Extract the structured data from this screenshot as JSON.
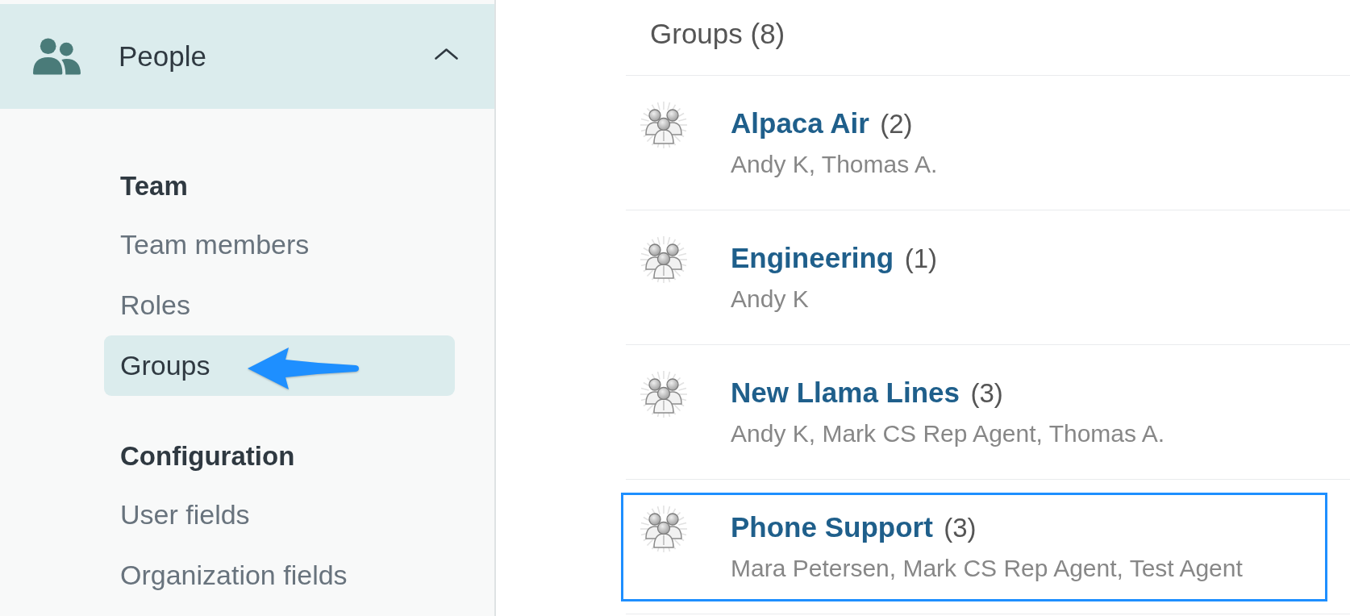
{
  "sidebar": {
    "section": {
      "label": "People",
      "expanded": true
    },
    "groups": [
      {
        "heading": "Team",
        "items": [
          {
            "label": "Team members",
            "selected": false,
            "arrow": false
          },
          {
            "label": "Roles",
            "selected": false,
            "arrow": false
          },
          {
            "label": "Groups",
            "selected": true,
            "arrow": true
          }
        ]
      },
      {
        "heading": "Configuration",
        "items": [
          {
            "label": "User fields",
            "selected": false,
            "arrow": false
          },
          {
            "label": "Organization fields",
            "selected": false,
            "arrow": false
          }
        ]
      }
    ]
  },
  "main": {
    "title": "Groups (8)",
    "groups": [
      {
        "name": "Alpaca Air",
        "count": "(2)",
        "members": "Andy K, Thomas A.",
        "outlined": false
      },
      {
        "name": "Engineering",
        "count": "(1)",
        "members": "Andy K",
        "outlined": false
      },
      {
        "name": "New Llama Lines",
        "count": "(3)",
        "members": "Andy K, Mark CS Rep Agent, Thomas A.",
        "outlined": false
      },
      {
        "name": "Phone Support",
        "count": "(3)",
        "members": "Mara Petersen, Mark CS Rep Agent, Test Agent",
        "outlined": true
      }
    ]
  }
}
